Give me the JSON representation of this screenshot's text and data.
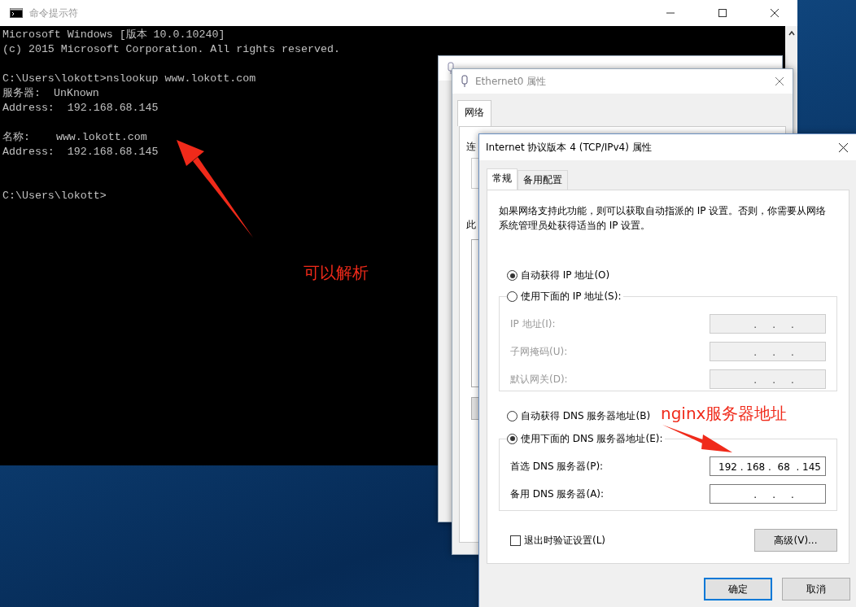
{
  "cmd_window": {
    "title": "命令提示符",
    "lines": [
      {
        "kind": "text",
        "text": "Microsoft Windows [版本 10.0.10240]"
      },
      {
        "kind": "text",
        "text": "(c) 2015 Microsoft Corporation. All rights reserved."
      },
      {
        "kind": "blank"
      },
      {
        "kind": "text",
        "text": "C:\\Users\\lokott>nslookup www.lokott.com"
      },
      {
        "kind": "text",
        "text": "服务器:  UnKnown"
      },
      {
        "kind": "text",
        "text": "Address:  192.168.68.145"
      },
      {
        "kind": "blank"
      },
      {
        "kind": "text",
        "text": "名称:    www.lokott.com"
      },
      {
        "kind": "text",
        "text": "Address:  192.168.68.145"
      },
      {
        "kind": "blank"
      },
      {
        "kind": "blank"
      },
      {
        "kind": "text",
        "text": "C:\\Users\\lokott>"
      }
    ]
  },
  "properties_window": {
    "title": "Ethernet0 属性",
    "tabs": [
      {
        "label": "网络",
        "selected": true
      }
    ],
    "partial_labels": [
      "连",
      "此"
    ]
  },
  "ipv4_dialog": {
    "title": "Internet 协议版本 4 (TCP/IPv4) 属性",
    "tabs": [
      {
        "label": "常规",
        "selected": true
      },
      {
        "label": "备用配置",
        "selected": false
      }
    ],
    "description": "如果网络支持此功能，则可以获取自动指派的 IP 设置。否则，你需要从网络系统管理员处获得适当的 IP 设置。",
    "ip_options": [
      {
        "label": "自动获得 IP 地址(O)",
        "selected": true
      },
      {
        "label": "使用下面的 IP 地址(S):",
        "selected": false
      }
    ],
    "ip_fields": [
      {
        "label": "IP 地址(I):",
        "value": "    .     .     .",
        "disabled": true
      },
      {
        "label": "子网掩码(U):",
        "value": "    .     .     .",
        "disabled": true
      },
      {
        "label": "默认网关(D):",
        "value": "    .     .     .",
        "disabled": true
      }
    ],
    "dns_options": [
      {
        "label": "自动获得 DNS 服务器地址(B)",
        "selected": false
      },
      {
        "label": "使用下面的 DNS 服务器地址(E):",
        "selected": true
      }
    ],
    "dns_fields": [
      {
        "label": "首选 DNS 服务器(P):",
        "value": "192 . 168 .  68  . 145",
        "disabled": false
      },
      {
        "label": "备用 DNS 服务器(A):",
        "value": "    .     .     .",
        "disabled": false
      }
    ],
    "validate_checkbox": {
      "label": "退出时验证设置(L)",
      "checked": false
    },
    "advanced_button": "高级(V)...",
    "buttons": [
      {
        "label": "确定",
        "default": true
      },
      {
        "label": "取消",
        "default": false
      }
    ]
  },
  "annotations": [
    {
      "text": "可以解析"
    },
    {
      "text": "nginx服务器地址"
    }
  ]
}
